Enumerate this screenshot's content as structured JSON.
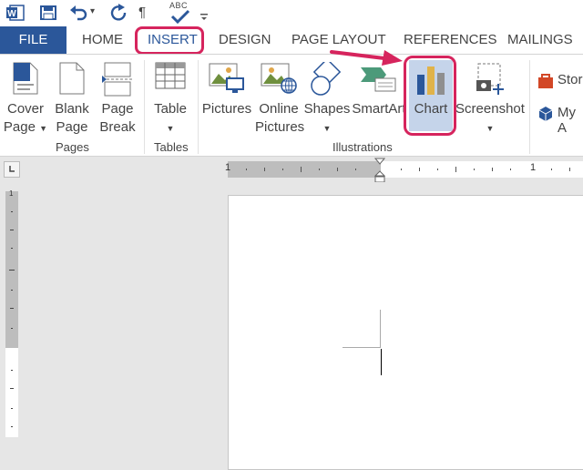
{
  "qat": {
    "app_icon": "word-icon",
    "save_icon": "save-icon",
    "undo_icon": "undo-icon",
    "undo_caret": "▾",
    "redo_icon": "redo-icon",
    "format_marks_icon": "pilcrow-icon",
    "format_marks_label": "¶",
    "spelling_label": "ABC",
    "spelling_icon": "spelling-check-icon",
    "customize_icon": "customize-qat-icon"
  },
  "tabs": {
    "file": "FILE",
    "home": "HOME",
    "insert": "INSERT",
    "design": "DESIGN",
    "page_layout": "PAGE LAYOUT",
    "references": "REFERENCES",
    "mailings": "MAILINGS"
  },
  "ribbon": {
    "pages": {
      "label": "Pages",
      "cover_page": {
        "line1": "Cover",
        "line2": "Page"
      },
      "blank_page": {
        "line1": "Blank",
        "line2": "Page"
      },
      "page_break": {
        "line1": "Page",
        "line2": "Break"
      }
    },
    "tables": {
      "label": "Tables",
      "table": {
        "line1": "Table"
      }
    },
    "illustrations": {
      "label": "Illustrations",
      "pictures": "Pictures",
      "online_pictures": {
        "line1": "Online",
        "line2": "Pictures"
      },
      "shapes": "Shapes",
      "smartart": "SmartArt",
      "chart": "Chart",
      "screenshot": "Screenshot"
    },
    "apps": {
      "store": "Stor",
      "my_apps": "My A"
    }
  },
  "ruler": {
    "left_label": "1",
    "right_label": "1",
    "vertical_label": "1"
  },
  "colors": {
    "accent": "#2b579a",
    "highlight": "#d6245d",
    "chart_selected_bg": "#c5d4ea"
  }
}
